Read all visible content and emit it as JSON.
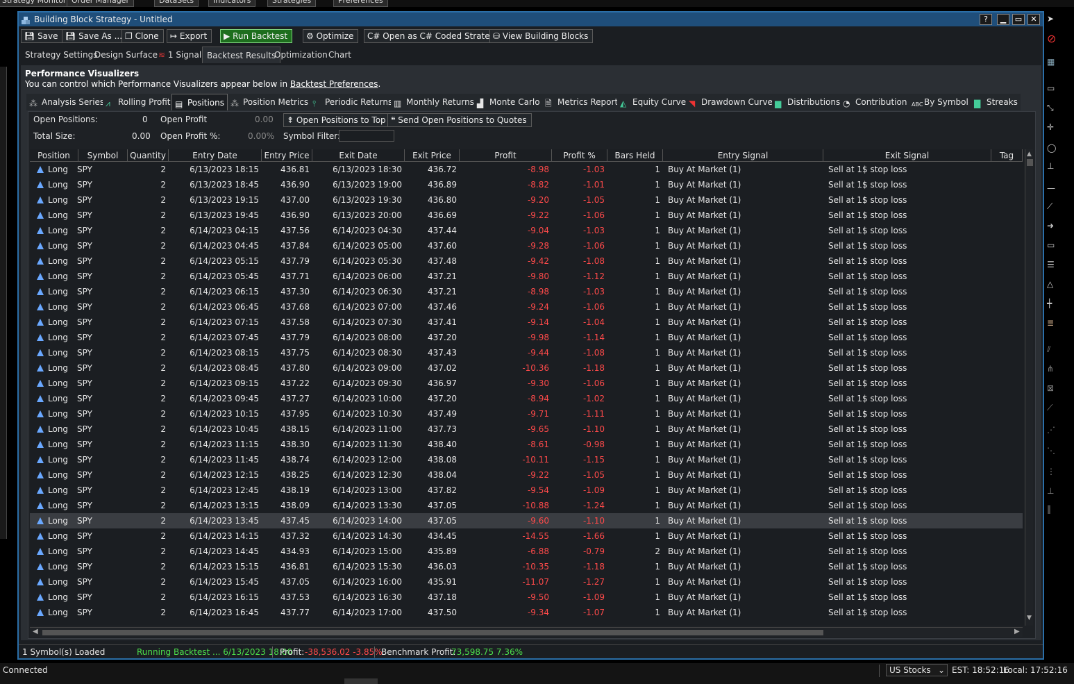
{
  "outer_menu": [
    "Strategy Monitor",
    "Order Manager",
    "DataSets",
    "Indicators",
    "Strategies",
    "Preferences"
  ],
  "window": {
    "title": "Building Block Strategy - Untitled",
    "help": "?"
  },
  "toolbar": {
    "save": "Save",
    "save_as": "Save As ...",
    "clone": "Clone",
    "export": "Export",
    "run_backtest": "Run Backtest",
    "optimize": "Optimize",
    "open_csharp": "Open as C# Coded Strategy",
    "view_blocks": "View Building Blocks"
  },
  "subtabs": [
    "Strategy Settings",
    "Design Surface",
    "1 Signal",
    "Backtest Results",
    "Optimization",
    "Chart"
  ],
  "perf": {
    "title": "Performance Visualizers",
    "subtitle_pre": "You can control which Performance Visualizers appear below in ",
    "subtitle_link": "Backtest Preferences",
    "subtitle_post": "."
  },
  "vistabs": [
    "Analysis Series",
    "Rolling Profit",
    "Positions",
    "Position Metrics",
    "Periodic Returns",
    "Monthly Returns",
    "Monte Carlo",
    "Metrics Report",
    "Equity Curve",
    "Drawdown Curve",
    "Distributions",
    "Contribution",
    "By Symbol",
    "Streaks"
  ],
  "summary": {
    "open_positions_label": "Open Positions:",
    "open_positions": "0",
    "open_profit_label": "Open Profit",
    "open_profit": "0.00",
    "total_size_label": "Total Size:",
    "total_size": "0.00",
    "open_profit_pct_label": "Open Profit %:",
    "open_profit_pct": "0.00%",
    "open_to_top": "Open Positions to Top",
    "send_to_quotes": "Send Open Positions to Quotes",
    "symbol_filter_label": "Symbol Filter:",
    "symbol_filter": ""
  },
  "columns": [
    "Position",
    "Symbol",
    "Quantity",
    "Entry Date",
    "Entry Price",
    "Exit Date",
    "Exit Price",
    "Profit",
    "Profit %",
    "Bars Held",
    "Entry Signal",
    "Exit Signal",
    "Tag"
  ],
  "rows": [
    [
      "Long",
      "SPY",
      "2",
      "6/13/2023 18:15",
      "436.81",
      "6/13/2023 18:30",
      "436.72",
      "-8.98",
      "-1.03",
      "1",
      "Buy At Market (1)",
      "Sell at 1$ stop loss",
      ""
    ],
    [
      "Long",
      "SPY",
      "2",
      "6/13/2023 18:45",
      "436.90",
      "6/13/2023 19:00",
      "436.89",
      "-8.82",
      "-1.01",
      "1",
      "Buy At Market (1)",
      "Sell at 1$ stop loss",
      ""
    ],
    [
      "Long",
      "SPY",
      "2",
      "6/13/2023 19:15",
      "437.00",
      "6/13/2023 19:30",
      "436.80",
      "-9.20",
      "-1.05",
      "1",
      "Buy At Market (1)",
      "Sell at 1$ stop loss",
      ""
    ],
    [
      "Long",
      "SPY",
      "2",
      "6/13/2023 19:45",
      "436.90",
      "6/13/2023 20:00",
      "436.69",
      "-9.22",
      "-1.06",
      "1",
      "Buy At Market (1)",
      "Sell at 1$ stop loss",
      ""
    ],
    [
      "Long",
      "SPY",
      "2",
      "6/14/2023 04:15",
      "437.56",
      "6/14/2023 04:30",
      "437.44",
      "-9.04",
      "-1.03",
      "1",
      "Buy At Market (1)",
      "Sell at 1$ stop loss",
      ""
    ],
    [
      "Long",
      "SPY",
      "2",
      "6/14/2023 04:45",
      "437.84",
      "6/14/2023 05:00",
      "437.60",
      "-9.28",
      "-1.06",
      "1",
      "Buy At Market (1)",
      "Sell at 1$ stop loss",
      ""
    ],
    [
      "Long",
      "SPY",
      "2",
      "6/14/2023 05:15",
      "437.79",
      "6/14/2023 05:30",
      "437.48",
      "-9.42",
      "-1.08",
      "1",
      "Buy At Market (1)",
      "Sell at 1$ stop loss",
      ""
    ],
    [
      "Long",
      "SPY",
      "2",
      "6/14/2023 05:45",
      "437.71",
      "6/14/2023 06:00",
      "437.21",
      "-9.80",
      "-1.12",
      "1",
      "Buy At Market (1)",
      "Sell at 1$ stop loss",
      ""
    ],
    [
      "Long",
      "SPY",
      "2",
      "6/14/2023 06:15",
      "437.30",
      "6/14/2023 06:30",
      "437.21",
      "-8.98",
      "-1.03",
      "1",
      "Buy At Market (1)",
      "Sell at 1$ stop loss",
      ""
    ],
    [
      "Long",
      "SPY",
      "2",
      "6/14/2023 06:45",
      "437.68",
      "6/14/2023 07:00",
      "437.46",
      "-9.24",
      "-1.06",
      "1",
      "Buy At Market (1)",
      "Sell at 1$ stop loss",
      ""
    ],
    [
      "Long",
      "SPY",
      "2",
      "6/14/2023 07:15",
      "437.58",
      "6/14/2023 07:30",
      "437.41",
      "-9.14",
      "-1.04",
      "1",
      "Buy At Market (1)",
      "Sell at 1$ stop loss",
      ""
    ],
    [
      "Long",
      "SPY",
      "2",
      "6/14/2023 07:45",
      "437.79",
      "6/14/2023 08:00",
      "437.20",
      "-9.98",
      "-1.14",
      "1",
      "Buy At Market (1)",
      "Sell at 1$ stop loss",
      ""
    ],
    [
      "Long",
      "SPY",
      "2",
      "6/14/2023 08:15",
      "437.75",
      "6/14/2023 08:30",
      "437.43",
      "-9.44",
      "-1.08",
      "1",
      "Buy At Market (1)",
      "Sell at 1$ stop loss",
      ""
    ],
    [
      "Long",
      "SPY",
      "2",
      "6/14/2023 08:45",
      "437.80",
      "6/14/2023 09:00",
      "437.02",
      "-10.36",
      "-1.18",
      "1",
      "Buy At Market (1)",
      "Sell at 1$ stop loss",
      ""
    ],
    [
      "Long",
      "SPY",
      "2",
      "6/14/2023 09:15",
      "437.22",
      "6/14/2023 09:30",
      "436.97",
      "-9.30",
      "-1.06",
      "1",
      "Buy At Market (1)",
      "Sell at 1$ stop loss",
      ""
    ],
    [
      "Long",
      "SPY",
      "2",
      "6/14/2023 09:45",
      "437.27",
      "6/14/2023 10:00",
      "437.20",
      "-8.94",
      "-1.02",
      "1",
      "Buy At Market (1)",
      "Sell at 1$ stop loss",
      ""
    ],
    [
      "Long",
      "SPY",
      "2",
      "6/14/2023 10:15",
      "437.95",
      "6/14/2023 10:30",
      "437.49",
      "-9.71",
      "-1.11",
      "1",
      "Buy At Market (1)",
      "Sell at 1$ stop loss",
      ""
    ],
    [
      "Long",
      "SPY",
      "2",
      "6/14/2023 10:45",
      "438.15",
      "6/14/2023 11:00",
      "437.73",
      "-9.65",
      "-1.10",
      "1",
      "Buy At Market (1)",
      "Sell at 1$ stop loss",
      ""
    ],
    [
      "Long",
      "SPY",
      "2",
      "6/14/2023 11:15",
      "438.30",
      "6/14/2023 11:30",
      "438.40",
      "-8.61",
      "-0.98",
      "1",
      "Buy At Market (1)",
      "Sell at 1$ stop loss",
      ""
    ],
    [
      "Long",
      "SPY",
      "2",
      "6/14/2023 11:45",
      "438.74",
      "6/14/2023 12:00",
      "438.08",
      "-10.11",
      "-1.15",
      "1",
      "Buy At Market (1)",
      "Sell at 1$ stop loss",
      ""
    ],
    [
      "Long",
      "SPY",
      "2",
      "6/14/2023 12:15",
      "438.25",
      "6/14/2023 12:30",
      "438.04",
      "-9.22",
      "-1.05",
      "1",
      "Buy At Market (1)",
      "Sell at 1$ stop loss",
      ""
    ],
    [
      "Long",
      "SPY",
      "2",
      "6/14/2023 12:45",
      "438.19",
      "6/14/2023 13:00",
      "437.82",
      "-9.54",
      "-1.09",
      "1",
      "Buy At Market (1)",
      "Sell at 1$ stop loss",
      ""
    ],
    [
      "Long",
      "SPY",
      "2",
      "6/14/2023 13:15",
      "438.09",
      "6/14/2023 13:30",
      "437.05",
      "-10.88",
      "-1.24",
      "1",
      "Buy At Market (1)",
      "Sell at 1$ stop loss",
      ""
    ],
    [
      "Long",
      "SPY",
      "2",
      "6/14/2023 13:45",
      "437.45",
      "6/14/2023 14:00",
      "437.05",
      "-9.60",
      "-1.10",
      "1",
      "Buy At Market (1)",
      "Sell at 1$ stop loss",
      ""
    ],
    [
      "Long",
      "SPY",
      "2",
      "6/14/2023 14:15",
      "437.32",
      "6/14/2023 14:30",
      "434.45",
      "-14.55",
      "-1.66",
      "1",
      "Buy At Market (1)",
      "Sell at 1$ stop loss",
      ""
    ],
    [
      "Long",
      "SPY",
      "2",
      "6/14/2023 14:45",
      "434.93",
      "6/14/2023 15:00",
      "435.89",
      "-6.88",
      "-0.79",
      "2",
      "Buy At Market (1)",
      "Sell at 1$ stop loss",
      ""
    ],
    [
      "Long",
      "SPY",
      "2",
      "6/14/2023 15:15",
      "436.81",
      "6/14/2023 15:30",
      "436.03",
      "-10.35",
      "-1.18",
      "1",
      "Buy At Market (1)",
      "Sell at 1$ stop loss",
      ""
    ],
    [
      "Long",
      "SPY",
      "2",
      "6/14/2023 15:45",
      "437.05",
      "6/14/2023 16:00",
      "435.91",
      "-11.07",
      "-1.27",
      "1",
      "Buy At Market (1)",
      "Sell at 1$ stop loss",
      ""
    ],
    [
      "Long",
      "SPY",
      "2",
      "6/14/2023 16:15",
      "437.53",
      "6/14/2023 16:30",
      "437.18",
      "-9.50",
      "-1.09",
      "1",
      "Buy At Market (1)",
      "Sell at 1$ stop loss",
      ""
    ],
    [
      "Long",
      "SPY",
      "2",
      "6/14/2023 16:45",
      "437.77",
      "6/14/2023 17:00",
      "437.50",
      "-9.34",
      "-1.07",
      "1",
      "Buy At Market (1)",
      "Sell at 1$ stop loss",
      ""
    ]
  ],
  "selected_row": 23,
  "status": {
    "symbols_loaded": "1 Symbol(s) Loaded",
    "running": "Running Backtest ... 6/13/2023 18:00",
    "profit_label": "Profit:",
    "profit_value": "-38,536.02 -3.85%",
    "benchmark_label": "Benchmark Profit:",
    "benchmark_value": "73,598.75 7.36%"
  },
  "bottom": {
    "connected": "Connected",
    "market": "US Stocks",
    "est": "EST: 18:52:16",
    "local": "Local: 17:52:16"
  },
  "colors": {
    "accent": "#2b6fa8",
    "negative": "#ff4a4a",
    "positive": "#4ce04c",
    "run_green": "#1e6e1e"
  }
}
